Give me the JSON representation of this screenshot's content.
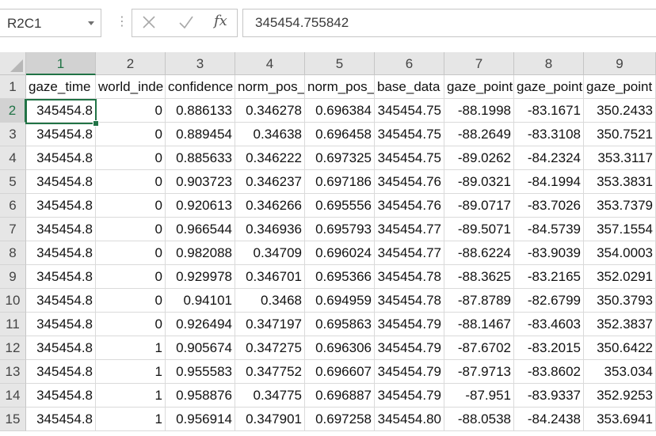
{
  "name_box": {
    "value": "R2C1"
  },
  "formula_bar": {
    "fx_label": "fx",
    "value": "345454.755842"
  },
  "columns": [
    "1",
    "2",
    "3",
    "4",
    "5",
    "6",
    "7",
    "8",
    "9"
  ],
  "rows": [
    {
      "n": "1",
      "cells": [
        "gaze_time",
        "world_inde",
        "confidence",
        "norm_pos_",
        "norm_pos_",
        "base_data",
        "gaze_point",
        "gaze_point",
        "gaze_point"
      ]
    },
    {
      "n": "2",
      "cells": [
        "345454.8",
        "0",
        "0.886133",
        "0.346278",
        "0.696384",
        "345454.75",
        "-88.1998",
        "-83.1671",
        "350.2433"
      ]
    },
    {
      "n": "3",
      "cells": [
        "345454.8",
        "0",
        "0.889454",
        "0.34638",
        "0.696458",
        "345454.75",
        "-88.2649",
        "-83.3108",
        "350.7521"
      ]
    },
    {
      "n": "4",
      "cells": [
        "345454.8",
        "0",
        "0.885633",
        "0.346222",
        "0.697325",
        "345454.75",
        "-89.0262",
        "-84.2324",
        "353.3117"
      ]
    },
    {
      "n": "5",
      "cells": [
        "345454.8",
        "0",
        "0.903723",
        "0.346237",
        "0.697186",
        "345454.76",
        "-89.0321",
        "-84.1994",
        "353.3831"
      ]
    },
    {
      "n": "6",
      "cells": [
        "345454.8",
        "0",
        "0.920613",
        "0.346266",
        "0.695556",
        "345454.76",
        "-89.0717",
        "-83.7026",
        "353.7379"
      ]
    },
    {
      "n": "7",
      "cells": [
        "345454.8",
        "0",
        "0.966544",
        "0.346936",
        "0.695793",
        "345454.77",
        "-89.5071",
        "-84.5739",
        "357.1554"
      ]
    },
    {
      "n": "8",
      "cells": [
        "345454.8",
        "0",
        "0.982088",
        "0.34709",
        "0.696024",
        "345454.77",
        "-88.6224",
        "-83.9039",
        "354.0003"
      ]
    },
    {
      "n": "9",
      "cells": [
        "345454.8",
        "0",
        "0.929978",
        "0.346701",
        "0.695366",
        "345454.78",
        "-88.3625",
        "-83.2165",
        "352.0291"
      ]
    },
    {
      "n": "10",
      "cells": [
        "345454.8",
        "0",
        "0.94101",
        "0.3468",
        "0.694959",
        "345454.78",
        "-87.8789",
        "-82.6799",
        "350.3793"
      ]
    },
    {
      "n": "11",
      "cells": [
        "345454.8",
        "0",
        "0.926494",
        "0.347197",
        "0.695863",
        "345454.79",
        "-88.1467",
        "-83.4603",
        "352.3837"
      ]
    },
    {
      "n": "12",
      "cells": [
        "345454.8",
        "1",
        "0.905674",
        "0.347275",
        "0.696306",
        "345454.79",
        "-87.6702",
        "-83.2015",
        "350.6422"
      ]
    },
    {
      "n": "13",
      "cells": [
        "345454.8",
        "1",
        "0.955583",
        "0.347752",
        "0.696607",
        "345454.79",
        "-87.9713",
        "-83.8602",
        "353.034"
      ]
    },
    {
      "n": "14",
      "cells": [
        "345454.8",
        "1",
        "0.958876",
        "0.34775",
        "0.696887",
        "345454.79",
        "-87.951",
        "-83.9337",
        "352.9253"
      ]
    },
    {
      "n": "15",
      "cells": [
        "345454.8",
        "1",
        "0.956914",
        "0.347901",
        "0.697258",
        "345454.80",
        "-88.0538",
        "-84.2438",
        "353.6941"
      ]
    }
  ],
  "selected": {
    "row": "2",
    "col": "1"
  },
  "colors": {
    "accent": "#217346",
    "header_bg": "#e6e6e6",
    "gridline": "#dadada"
  },
  "icons": {
    "cancel": "close-icon",
    "enter": "check-icon",
    "fx": "function-icon"
  }
}
